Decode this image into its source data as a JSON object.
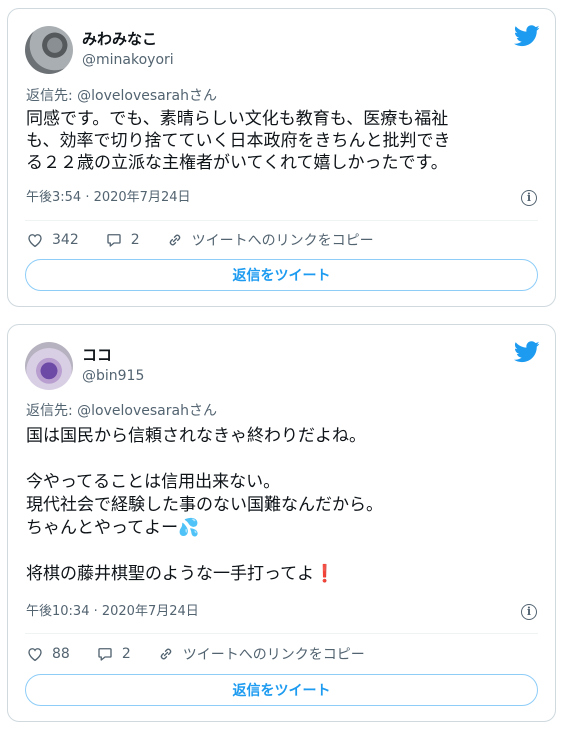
{
  "tweets": [
    {
      "name": "みわみなこ",
      "handle": "@minakoyori",
      "reply_to": "返信先: @lovelovesarahさん",
      "text": "同感です。でも、素晴らしい文化も教育も、医療も福祉\nも、効率で切り捨てていく日本政府をきちんと批判でき\nる２２歳の立派な主権者がいてくれて嬉しかったです。",
      "timestamp": "午後3:54 · 2020年7月24日",
      "likes": "342",
      "replies": "2",
      "copy_link": "ツイートへのリンクをコピー",
      "reply_button": "返信をツイート"
    },
    {
      "name": "ココ",
      "handle": "@bin915",
      "reply_to": "返信先: @lovelovesarahさん",
      "text": "国は国民から信頼されなきゃ終わりだよね。\n\n今やってることは信用出来ない。\n現代社会で経験した事のない国難なんだから。\nちゃんとやってよー💦\n\n将棋の藤井棋聖のような一手打ってよ❗",
      "timestamp": "午後10:34 · 2020年7月24日",
      "likes": "88",
      "replies": "2",
      "copy_link": "ツイートへのリンクをコピー",
      "reply_button": "返信をツイート"
    }
  ],
  "icons": {
    "brand": "twitter-bird-icon",
    "like": "heart-icon",
    "reply": "speech-bubble-icon",
    "link": "link-icon",
    "info": "info-icon"
  },
  "colors": {
    "accent": "#1d9bf0",
    "muted_text": "#536471",
    "border": "#cfd9de"
  }
}
